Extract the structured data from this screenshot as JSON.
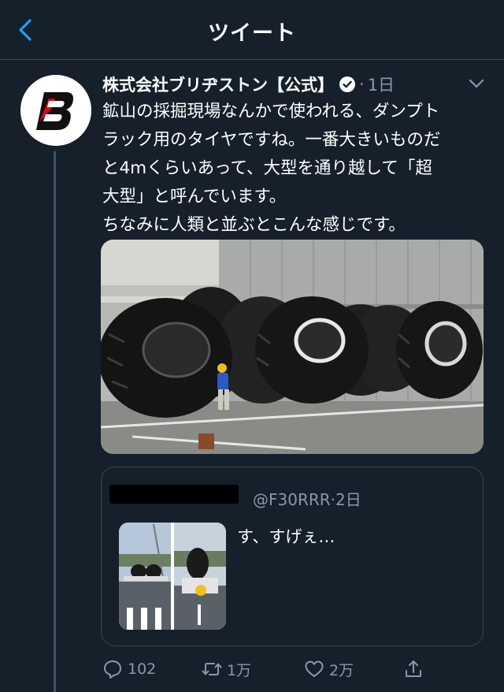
{
  "header": {
    "title": "ツイート",
    "back_icon": "chevron-left-icon"
  },
  "colors": {
    "background": "#15202b",
    "accent": "#1da1f2",
    "secondary": "#8899a6",
    "border": "#38444d",
    "brand_red": "#e60012"
  },
  "tweet": {
    "author": "株式会社ブリヂストン【公式】",
    "separator": "·",
    "time": "1日",
    "text_lines": [
      "鉱山の採掘現場なんかで使われる、ダンプト",
      "ラック用のタイヤですね。一番大きいものだ",
      "と4mくらいあって、大型を通り越して「超",
      "大型」と呼んでいます。",
      "ちなみに人類と並ぶとこんな感じです。"
    ]
  },
  "quote": {
    "handle": "@F30RRR",
    "separator": "·",
    "time": "2日",
    "text": "す、すげぇ…"
  },
  "actions": {
    "reply_count": "102",
    "retweet_count": "1万",
    "like_count": "2万"
  }
}
